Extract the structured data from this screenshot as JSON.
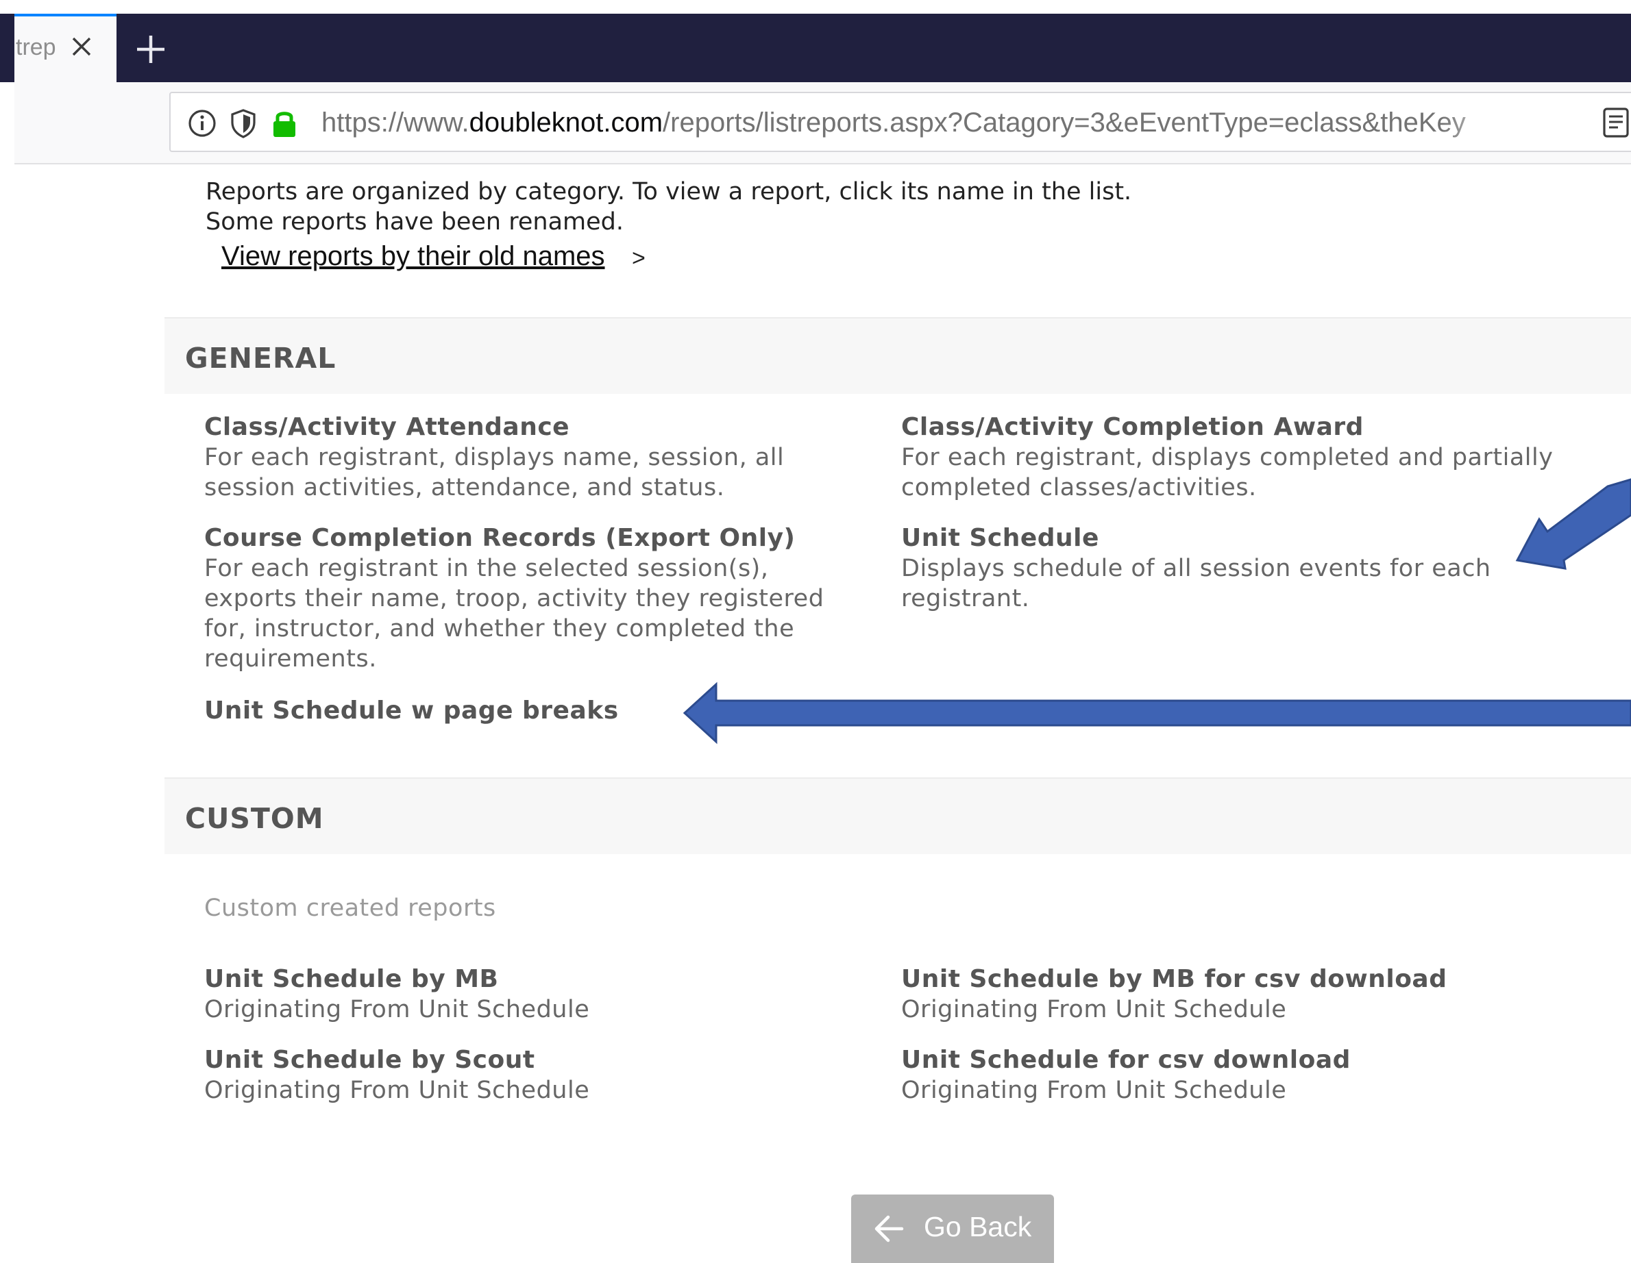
{
  "browser": {
    "tab_title": "trep",
    "url_prefix": "https://www.",
    "url_host": "doubleknot.com",
    "url_path": "/reports/listreports.aspx?Catagory=3&eEventType=eclass&theKey"
  },
  "intro": {
    "line1": "Reports are organized by category. To view a report, click its name in the list.",
    "line2": "Some reports have been renamed.",
    "old_names_link": "View reports by their old names",
    "chevron": ">"
  },
  "general": {
    "title": "GENERAL",
    "reports": [
      {
        "title": "Class/Activity Attendance",
        "desc": "For each registrant, displays name, session, all session activities, attendance, and status."
      },
      {
        "title": "Class/Activity Completion Award",
        "desc": "For each registrant, displays completed and partially completed classes/activities."
      },
      {
        "title": "Course Completion Records (Export Only)",
        "desc": "For each registrant in the selected session(s), exports their name, troop, activity they registered for, instructor, and whether they completed the requirements."
      },
      {
        "title": "Unit Schedule",
        "desc": "Displays schedule of all session events for each registrant."
      },
      {
        "title": "Unit Schedule w page breaks",
        "desc": ""
      }
    ]
  },
  "custom": {
    "title": "CUSTOM",
    "subtitle": "Custom created reports",
    "reports": [
      {
        "title": "Unit Schedule by MB",
        "desc": "Originating From Unit Schedule"
      },
      {
        "title": "Unit Schedule by MB for csv download",
        "desc": "Originating From Unit Schedule"
      },
      {
        "title": "Unit Schedule by Scout",
        "desc": "Originating From Unit Schedule"
      },
      {
        "title": "Unit Schedule for csv download",
        "desc": "Originating From Unit Schedule"
      }
    ]
  },
  "footer": {
    "go_back_label": "Go Back"
  },
  "colors": {
    "tabbar": "#20203f",
    "annotation_arrow": "#3e63b4",
    "lock_green": "#12bc00",
    "go_back_bg": "#b3b3b3"
  }
}
